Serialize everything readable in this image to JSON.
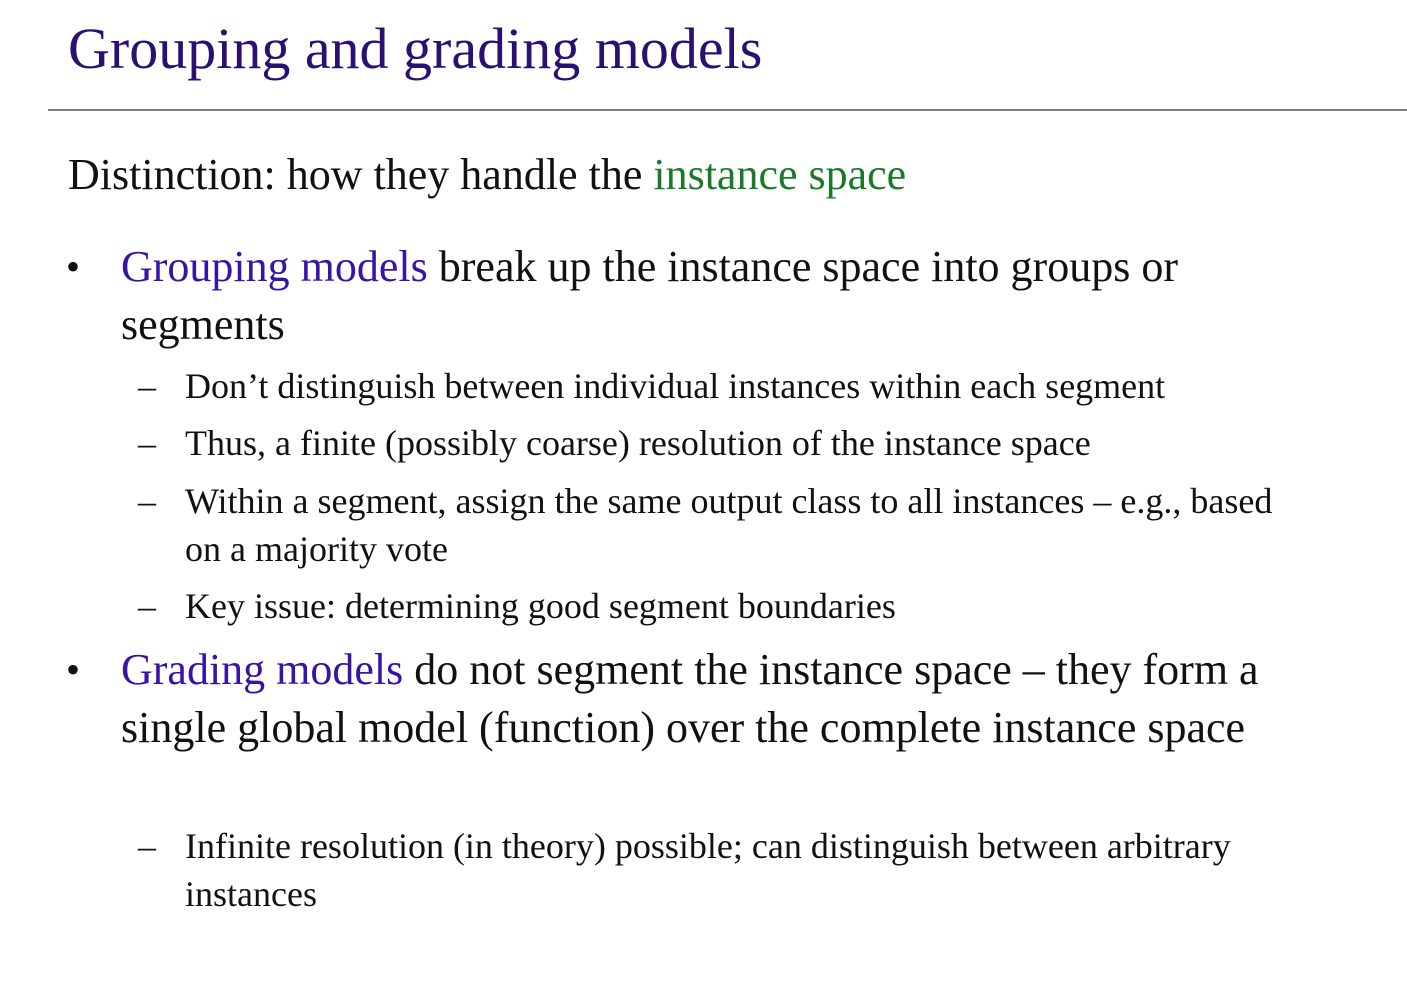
{
  "slide": {
    "title": "Grouping and grading models",
    "intro": {
      "prefix": "Distinction: how they handle the ",
      "highlight": "instance space"
    },
    "bullets": [
      {
        "marker": "•",
        "term": "Grouping models",
        "rest": " break up the instance space into groups or segments",
        "subitems": [
          {
            "marker": "–",
            "text": "Don’t distinguish between individual instances within each segment"
          },
          {
            "marker": "–",
            "text": "Thus, a finite (possibly coarse) resolution of the instance space"
          },
          {
            "marker": "–",
            "text": "Within a segment, assign the same output class to all instances – e.g., based on a majority vote"
          },
          {
            "marker": "–",
            "text": "Key issue: determining good segment boundaries"
          }
        ]
      },
      {
        "marker": "•",
        "term": "Grading models",
        "rest": " do not segment the instance space – they form a single global model (function) over the complete instance space",
        "subitems": [
          {
            "marker": "–",
            "text": "Infinite resolution (in theory) possible; can distinguish between arbitrary instances"
          }
        ]
      }
    ]
  },
  "colors": {
    "title": "#2a1073",
    "term": "#3a13a6",
    "highlight": "#1b7a2a",
    "rule": "#7c7c7c"
  }
}
